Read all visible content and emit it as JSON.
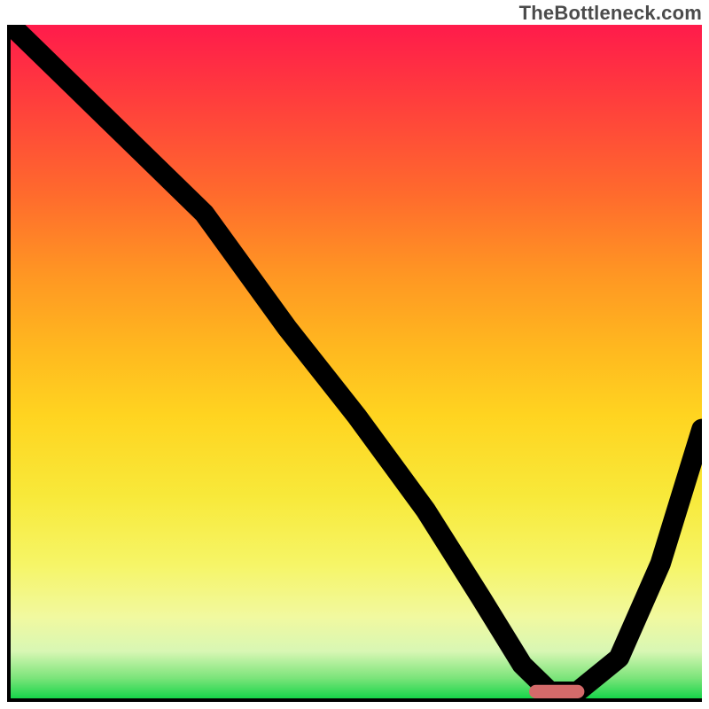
{
  "watermark": "TheBottleneck.com",
  "chart_data": {
    "type": "line",
    "title": "",
    "xlabel": "",
    "ylabel": "",
    "xlim": [
      0,
      100
    ],
    "ylim": [
      0,
      100
    ],
    "x": [
      0,
      10,
      20,
      28,
      40,
      50,
      60,
      68,
      74,
      78,
      82,
      88,
      94,
      100
    ],
    "values": [
      100,
      90,
      80,
      72,
      55,
      42,
      28,
      15,
      5,
      1,
      1,
      6,
      20,
      40
    ],
    "optimum_marker": {
      "x_start": 75,
      "x_end": 83,
      "y": 1
    },
    "gradient_stops": [
      {
        "pct": 0,
        "color": "#ff1b4b"
      },
      {
        "pct": 25,
        "color": "#ff6a2d"
      },
      {
        "pct": 50,
        "color": "#ffc21f"
      },
      {
        "pct": 75,
        "color": "#f7f050"
      },
      {
        "pct": 95,
        "color": "#b6f29a"
      },
      {
        "pct": 100,
        "color": "#17d54a"
      }
    ]
  }
}
